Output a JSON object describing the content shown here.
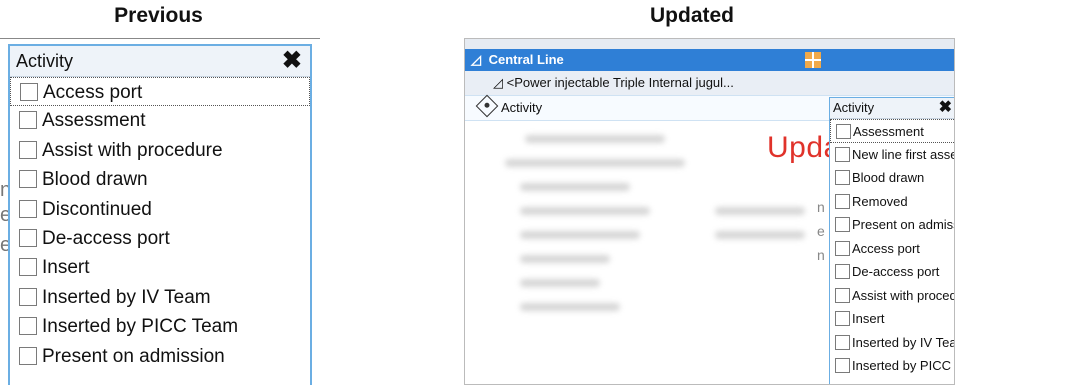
{
  "headings": {
    "previous": "Previous",
    "updated": "Updated"
  },
  "previous_panel": {
    "popup_title": "Activity",
    "close_glyph": "✖",
    "items": [
      "Access port",
      "Assessment",
      "Assist with procedure",
      "Blood drawn",
      "Discontinued",
      "De-access port",
      "Insert",
      "Inserted by IV Team",
      "Inserted by PICC Team",
      "Present on admission"
    ],
    "focused_index": 0
  },
  "updated_panel": {
    "central_line": "Central Line",
    "power_row": "<Power injectable Triple Internal jugul...",
    "activity_row": "Activity",
    "stamp": "Updated",
    "popup_title": "Activity",
    "close_glyph": "✖",
    "items": [
      "Assessment",
      "New line first assessment",
      "Blood drawn",
      "Removed",
      "Present on admission",
      "Access port",
      "De-access port",
      "Assist with procedure",
      "Insert",
      "Inserted by IV Team",
      "Inserted by PICC Team"
    ],
    "focused_index": 0
  },
  "icons": {
    "close": "close-icon",
    "tree_expand": "tree-collapse-triangle-icon",
    "activity": "activity-diamond-icon",
    "grid": "grid-settings-icon",
    "checkbox": "checkbox-icon"
  },
  "colors": {
    "accent_blue": "#2f7fd6",
    "popup_border": "#6baee3",
    "stamp_red": "#e0322a"
  }
}
